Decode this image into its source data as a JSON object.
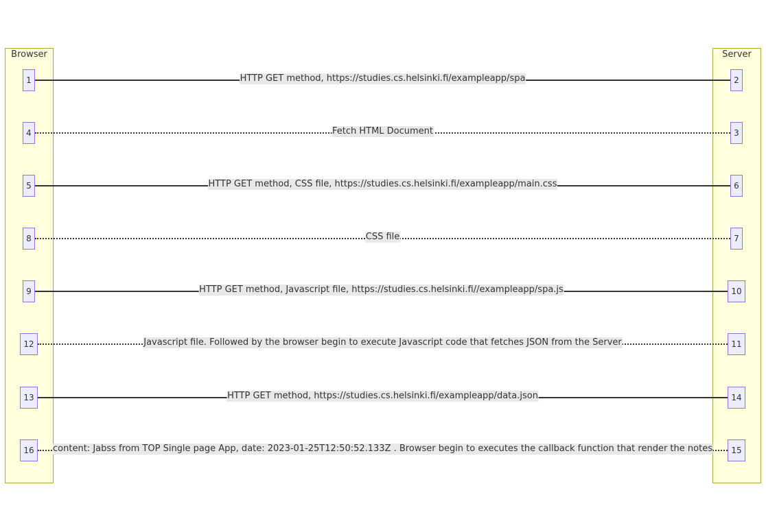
{
  "lanes": {
    "browser": "Browser",
    "server": "Server"
  },
  "rows": [
    {
      "left_node": "1",
      "right_node": "2",
      "style": "solid",
      "label": "HTTP GET method, https://studies.cs.helsinki.fi/exampleapp/spa"
    },
    {
      "left_node": "4",
      "right_node": "3",
      "style": "dotted",
      "label": "Fetch HTML Document"
    },
    {
      "left_node": "5",
      "right_node": "6",
      "style": "solid",
      "label": "HTTP GET method, CSS file, https://studies.cs.helsinki.fi/exampleapp/main.css"
    },
    {
      "left_node": "8",
      "right_node": "7",
      "style": "dotted",
      "label": "CSS file"
    },
    {
      "left_node": "9",
      "right_node": "10",
      "style": "solid",
      "label": "HTTP GET method, Javascript file, https://studies.cs.helsinki.fi//exampleapp/spa.js"
    },
    {
      "left_node": "12",
      "right_node": "11",
      "style": "dotted",
      "label": "Javascript file. Followed by the browser begin to execute Javascript code that fetches JSON from the Server"
    },
    {
      "left_node": "13",
      "right_node": "14",
      "style": "solid",
      "label": "HTTP GET method, https://studies.cs.helsinki.fi/exampleapp/data.json"
    },
    {
      "left_node": "16",
      "right_node": "15",
      "style": "dotted",
      "label": "content: Jabss from TOP Single page App, date: 2023-01-25T12:50:52.133Z . Browser begin to executes the callback function that render the notes"
    }
  ]
}
